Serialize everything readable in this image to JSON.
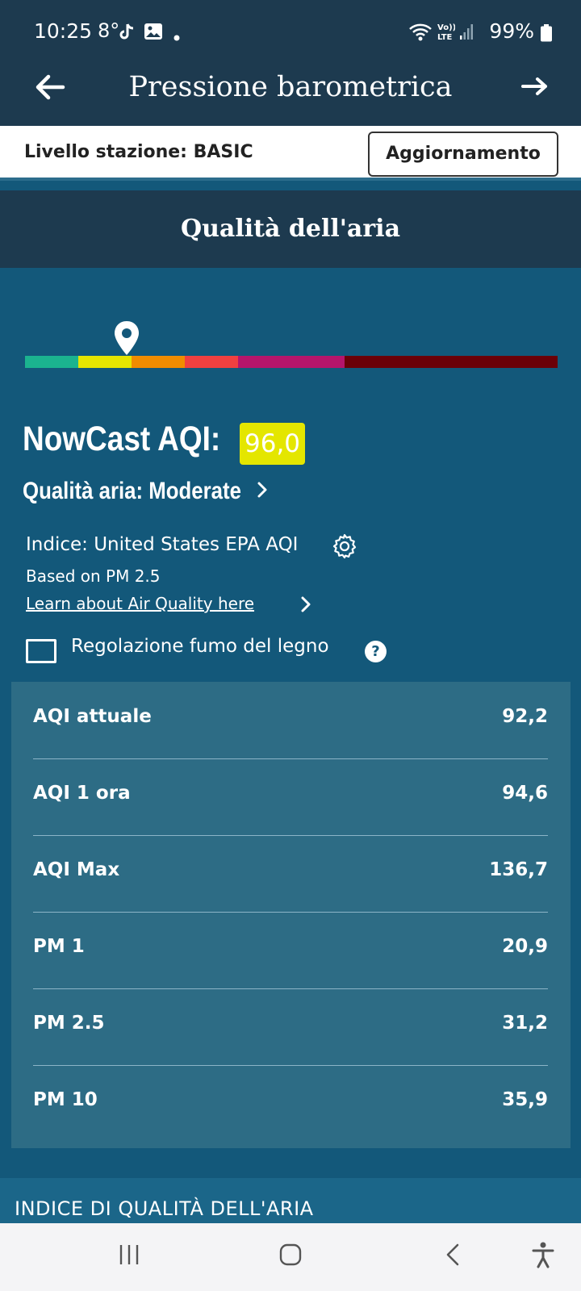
{
  "status_bar": {
    "time": "10:25",
    "temperature": "8°",
    "battery": "99%",
    "icons": [
      "tiktok-icon",
      "image-icon",
      "dot-icon",
      "wifi-icon",
      "volte-icon",
      "signal-icon",
      "battery-icon"
    ]
  },
  "app_bar": {
    "title": "Pressione barometrica",
    "back_icon": "arrow-left-icon",
    "next_icon": "arrow-right-icon"
  },
  "station": {
    "level_label": "Livello stazione: BASIC",
    "upgrade_button": "Aggiornamento"
  },
  "section": {
    "title": "Qualità dell'aria"
  },
  "scale": {
    "segment_colors": [
      "#1bb38f",
      "#e5e500",
      "#f08c00",
      "#f04040",
      "#b5156b",
      "#b5156b",
      "#6b0008",
      "#6b0008",
      "#6b0008",
      "#6b0008"
    ],
    "marker_segment": 1,
    "marker_icon": "location-pin-icon"
  },
  "aqi": {
    "title": "NowCast AQI:",
    "value": "96,0",
    "badge_color": "#e4e600",
    "quality_text": "Qualità aria: Moderate",
    "index_text": "Indice: United States EPA AQI",
    "based_on": "Based on PM 2.5",
    "learn_link": "Learn about Air Quality here"
  },
  "smoke": {
    "label": "Regolazione fumo del legno",
    "checked": false,
    "help_glyph": "?"
  },
  "metrics": [
    {
      "name": "AQI attuale",
      "value": "92,2"
    },
    {
      "name": "AQI 1 ora",
      "value": "94,6"
    },
    {
      "name": "AQI Max",
      "value": "136,7"
    },
    {
      "name": "PM 1",
      "value": "20,9"
    },
    {
      "name": "PM 2.5",
      "value": "31,2"
    },
    {
      "name": "PM 10",
      "value": "35,9"
    }
  ],
  "footer": {
    "heading": "INDICE DI QUALITÀ DELL'ARIA"
  },
  "nav_bar": {
    "icons": [
      "recent-apps-icon",
      "home-icon",
      "back-icon",
      "accessibility-icon"
    ]
  }
}
